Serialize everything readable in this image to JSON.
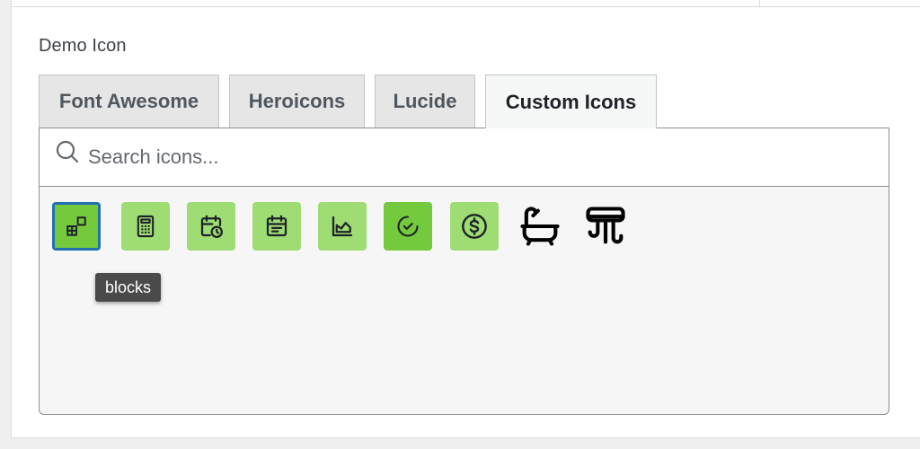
{
  "field": {
    "label": "Demo Icon"
  },
  "tabs": [
    {
      "label": "Font Awesome",
      "active": false
    },
    {
      "label": "Heroicons",
      "active": false
    },
    {
      "label": "Lucide",
      "active": false
    },
    {
      "label": "Custom Icons",
      "active": true
    }
  ],
  "search": {
    "placeholder": "Search icons...",
    "value": "",
    "icon": "search-icon"
  },
  "icons": [
    {
      "name": "blocks",
      "state": "selected"
    },
    {
      "name": "calculator",
      "state": "default"
    },
    {
      "name": "calendar-clock",
      "state": "default"
    },
    {
      "name": "calendar-lines",
      "state": "default"
    },
    {
      "name": "chart-area",
      "state": "default"
    },
    {
      "name": "circle-check",
      "state": "hover"
    },
    {
      "name": "circle-dollar",
      "state": "default"
    },
    {
      "name": "bathtub",
      "state": "plain"
    },
    {
      "name": "shower-drain",
      "state": "plain"
    }
  ],
  "tooltip": {
    "text": "blocks"
  },
  "colors": {
    "tile_default": "#9fdc73",
    "tile_active": "#74c93c",
    "selected_border": "#2271b1",
    "tooltip_bg": "#4a4a4a"
  }
}
